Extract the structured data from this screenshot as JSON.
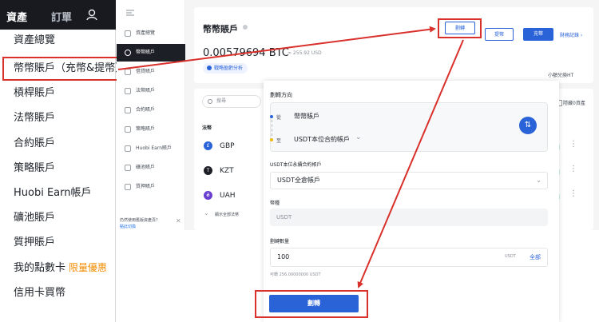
{
  "left_menu": {
    "tab_assets": "資產",
    "tab_orders": "訂單",
    "items": [
      {
        "label": "資產總覽",
        "badge": ""
      },
      {
        "label": "幣幣賬戶（充幣&提幣）",
        "badge": ""
      },
      {
        "label": "槓桿賬戶",
        "badge": ""
      },
      {
        "label": "法幣賬戶",
        "badge": ""
      },
      {
        "label": "合約賬戶",
        "badge": ""
      },
      {
        "label": "策略賬戶",
        "badge": ""
      },
      {
        "label": "Huobi Earn帳戶",
        "badge": ""
      },
      {
        "label": "礦池賬戶",
        "badge": ""
      },
      {
        "label": "質押賬戶",
        "badge": ""
      },
      {
        "label": "我的點數卡",
        "badge": "限量優惠"
      },
      {
        "label": "信用卡買幣",
        "badge": ""
      }
    ],
    "highlight_color": "#d9302b"
  },
  "sidebar": {
    "items": [
      "資產總覽",
      "幣幣賬戶",
      "借貸賬戶",
      "法幣賬戶",
      "合約賬戶",
      "策略賬戶",
      "Huobi Earn賬戶",
      "礦池賬戶",
      "質押賬戶"
    ],
    "active_index": 1,
    "tip_question": "仍然使用舊版資產頁？",
    "tip_link": "點此切換"
  },
  "account": {
    "title": "幣幣賬戶",
    "balance": "0.00579694 BTC",
    "fiat": "≈ 255.92 USD",
    "analysis": "戰略盈虧分析",
    "btn_transfer": "劃轉",
    "btn_withdraw": "提幣",
    "btn_deposit": "充幣",
    "records": "財務記錄 ›",
    "small_convert": "小額兌換HT"
  },
  "assets": {
    "search_placeholder": "搜尋",
    "hide_zero": "隱藏0資產",
    "column_head": "法幣",
    "coins": [
      {
        "symbol": "£",
        "name": "GBP",
        "color": "#2a63d8",
        "action": "充值"
      },
      {
        "symbol": "T",
        "name": "KZT",
        "color": "#1c1f26",
        "action": "充值"
      },
      {
        "symbol": "₴",
        "name": "UAH",
        "color": "#6a3fd0",
        "action": "充值"
      }
    ],
    "more_icon": "⋮",
    "show_all": "顯示全部法幣"
  },
  "modal": {
    "direction_label": "劃轉方向",
    "from_tag": "從",
    "from_value": "幣幣賬戶",
    "to_tag": "至",
    "to_value": "USDT本位合約帳戶",
    "contract_label": "USDT本位永續合約帳戶",
    "contract_value": "USDT全倉帳戶",
    "coin_label": "幣種",
    "coin_value": "USDT",
    "amount_label": "劃轉數量",
    "amount_value": "100",
    "amount_unit": "USDT",
    "amount_all": "全部",
    "available": "可轉 256.00000000 USDT",
    "submit": "劃轉"
  },
  "accent": "#2a63d8"
}
